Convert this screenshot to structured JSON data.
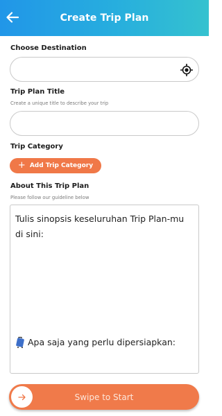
{
  "header": {
    "title": "Create Trip Plan"
  },
  "destination": {
    "label": "Choose Destination",
    "value": "",
    "placeholder": ""
  },
  "title_field": {
    "label": "Trip Plan Title",
    "hint": "Create a unique title to describe your trip",
    "value": "",
    "placeholder": ""
  },
  "category": {
    "label": "Trip Category",
    "button_label": "Add Trip Category"
  },
  "about": {
    "label": "About This Trip Plan",
    "hint": "Please follow our guideline below",
    "line1": "Tulis sinopsis keseluruhan Trip Plan-mu di sini:",
    "line2": "Apa saja yang perlu dipersiapkan:"
  },
  "swipe": {
    "label": "Swipe to Start"
  },
  "colors": {
    "header_start": "#2196e8",
    "header_end": "#35c2cf",
    "accent": "#f07848",
    "border": "#c9c9c9"
  },
  "icons": {
    "back": "arrow-left-icon",
    "location": "crosshair-icon",
    "plus": "plus-icon",
    "luggage": "luggage-icon",
    "swipe_arrow": "arrow-right-icon"
  }
}
